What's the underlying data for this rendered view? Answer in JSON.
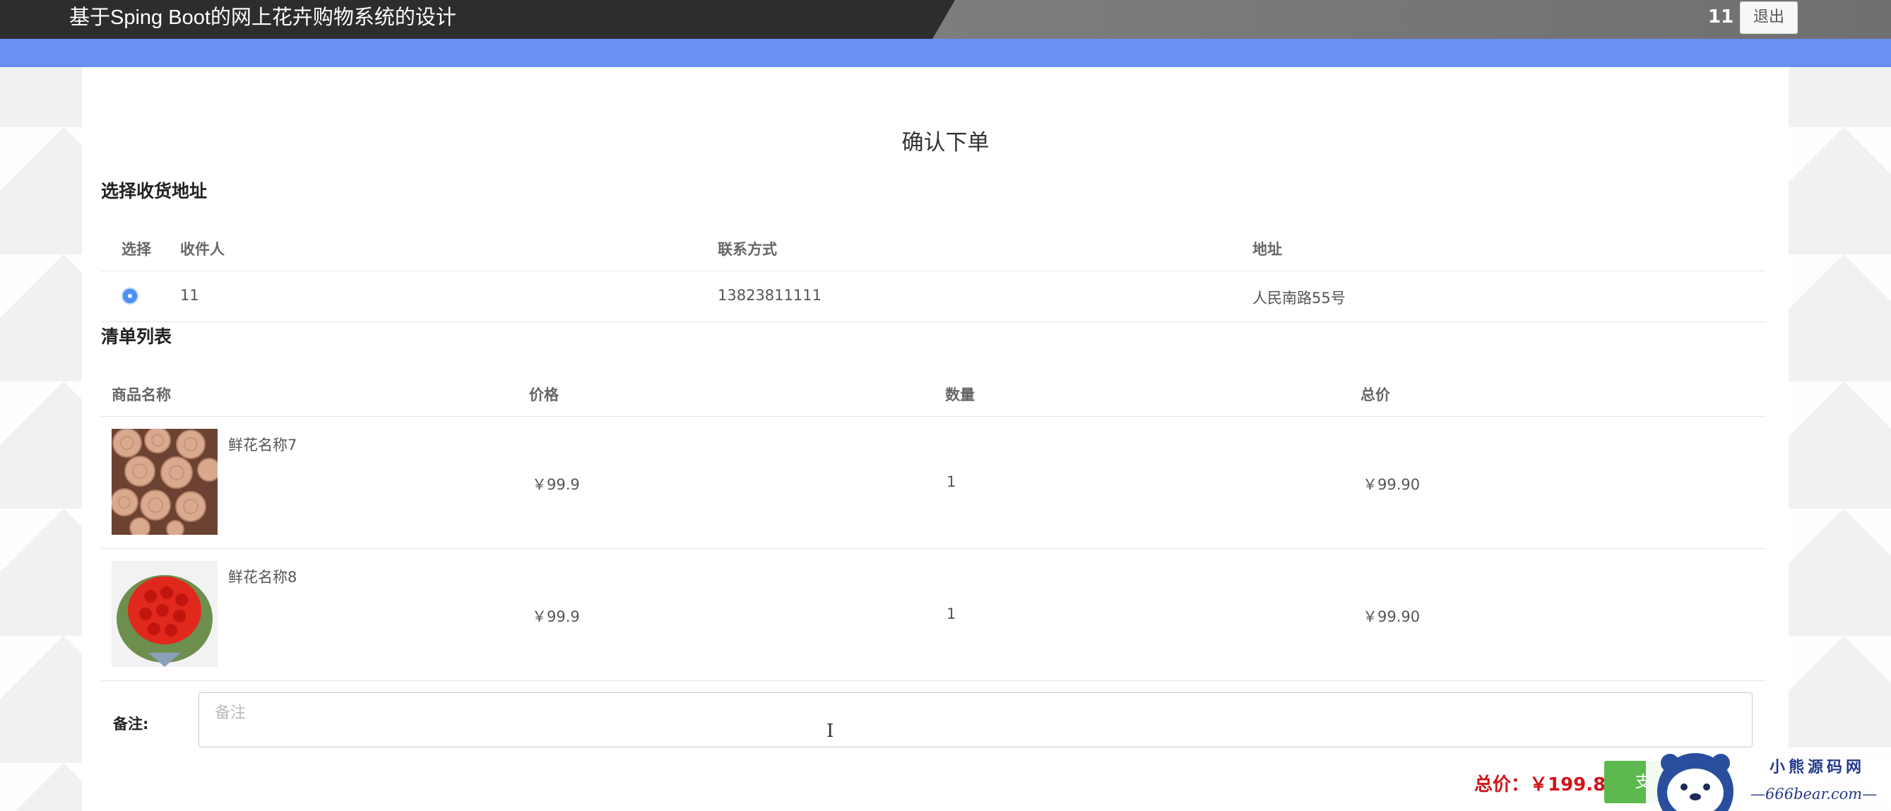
{
  "header": {
    "site_title": "基于Sping Boot的网上花卉购物系统的设计",
    "user_name": "11",
    "logout_label": "退出"
  },
  "page": {
    "heading": "确认下单"
  },
  "address_section": {
    "title": "选择收货地址",
    "columns": {
      "select": "选择",
      "recipient": "收件人",
      "phone": "联系方式",
      "address": "地址"
    },
    "rows": [
      {
        "selected": true,
        "recipient": "11",
        "phone": "13823811111",
        "address": "人民南路55号"
      }
    ]
  },
  "items_section": {
    "title": "清单列表",
    "columns": {
      "name": "商品名称",
      "price": "价格",
      "qty": "数量",
      "total": "总价"
    },
    "rows": [
      {
        "image": "rose-bouquet-photo",
        "name": "鲜花名称7",
        "price": "￥99.9",
        "qty": "1",
        "total": "￥99.90"
      },
      {
        "image": "red-rose-heart-photo",
        "name": "鲜花名称8",
        "price": "￥99.9",
        "qty": "1",
        "total": "￥99.90"
      }
    ]
  },
  "remark": {
    "label": "备注:",
    "placeholder": "备注"
  },
  "summary": {
    "total_text": "总价：￥199.80",
    "pay_label": "支"
  },
  "watermark": {
    "line1": "小熊源码网",
    "line2": "—666bear.com—"
  },
  "colors": {
    "topbar": "#2d2d2d",
    "blue_band": "#6a8ff5",
    "price_red": "#d0131a",
    "pay_green": "#5cb94d",
    "radio_blue": "#4a8ff0"
  }
}
